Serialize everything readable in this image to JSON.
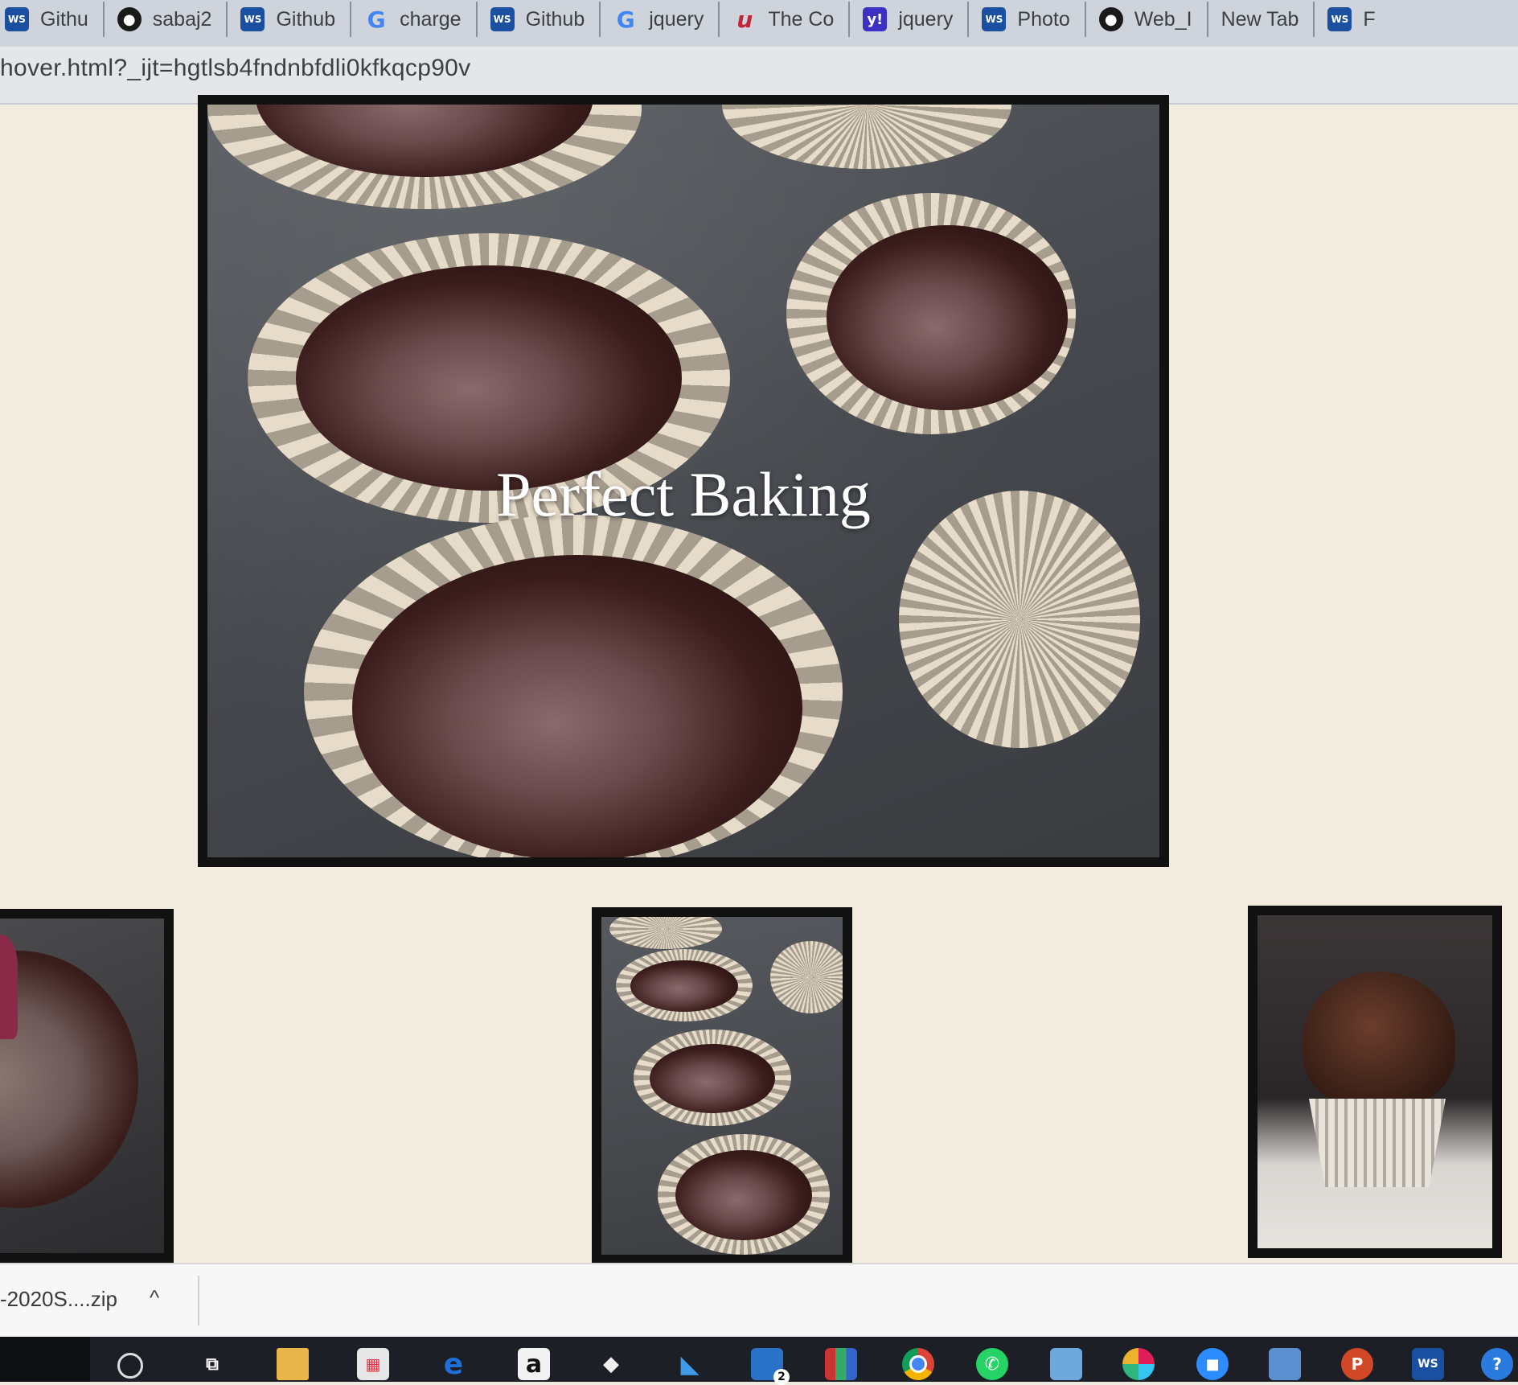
{
  "tabs": [
    {
      "label": "Githu",
      "icon": "webstorm-icon"
    },
    {
      "label": "sabaj2",
      "icon": "github-icon"
    },
    {
      "label": "Github",
      "icon": "webstorm-icon"
    },
    {
      "label": "charge",
      "icon": "google-icon"
    },
    {
      "label": "Github",
      "icon": "webstorm-icon"
    },
    {
      "label": "jquery",
      "icon": "google-icon"
    },
    {
      "label": "The Co",
      "icon": "udemy-icon"
    },
    {
      "label": "jquery",
      "icon": "yahoo-icon"
    },
    {
      "label": "Photo",
      "icon": "webstorm-icon"
    },
    {
      "label": "Web_I",
      "icon": "github-icon"
    },
    {
      "label": "New Tab",
      "icon": ""
    },
    {
      "label": "F",
      "icon": "webstorm-icon"
    }
  ],
  "address": {
    "url": "hover.html?_ijt=hgtlsb4fndnbfdli0kfkqcp90v"
  },
  "hero": {
    "caption": "Perfect Baking"
  },
  "downloads": {
    "file_name": "-2020S....zip",
    "chevron": "^"
  },
  "taskbar": {
    "icons": [
      "search-icon",
      "task-view-icon",
      "file-explorer-icon",
      "store-icon",
      "edge-icon",
      "amazon-icon",
      "dropbox-icon",
      "visual-studio-icon",
      "mail-icon",
      "winrar-icon",
      "chrome-icon",
      "whatsapp-icon",
      "virtualbox-icon",
      "slack-icon",
      "zoom-icon",
      "photos-icon",
      "powerpoint-icon",
      "webstorm-icon",
      "help-icon"
    ],
    "amazon_label": "a",
    "mail_badge": "2"
  }
}
